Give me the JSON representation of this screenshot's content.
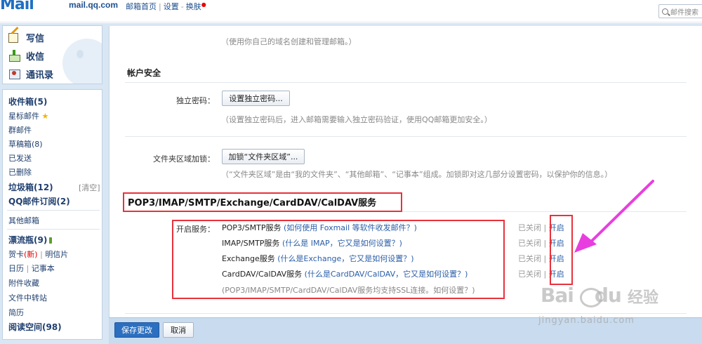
{
  "header": {
    "logo_text": "Mail",
    "logo_domain": "mail.qq.com",
    "nav": [
      "邮箱首页",
      "设置",
      "换肤"
    ],
    "search_placeholder": "邮件搜索"
  },
  "sidebar": {
    "actions": [
      {
        "label": "写信",
        "icon": "write-icon"
      },
      {
        "label": "收信",
        "icon": "inbox-icon"
      },
      {
        "label": "通讯录",
        "icon": "contacts-icon"
      }
    ],
    "inbox": "收件箱(5)",
    "starred": "星标邮件",
    "group": "群邮件",
    "drafts": "草稿箱(8)",
    "sent": "已发送",
    "deleted": "已删除",
    "spam": "垃圾箱(12)",
    "spam_clear": "[清空]",
    "subscriptions": "QQ邮件订阅(2)",
    "other": "其他邮箱",
    "drift": "漂流瓶(9)",
    "card": "贺卡",
    "card_new": "(新)",
    "postcard": "明信片",
    "calendar": "日历",
    "notes": "记事本",
    "attachments": "附件收藏",
    "transfer": "文件中转站",
    "resume": "简历",
    "reading": "阅读空间(98)",
    "bar": "|"
  },
  "main": {
    "domain_note": "（使用你自己的域名创建和管理邮箱。）",
    "account_security_title": "帐户安全",
    "independent_password_label": "独立密码：",
    "independent_password_button": "设置独立密码...",
    "independent_password_note": "（设置独立密码后，进入邮箱需要输入独立密码验证，使用QQ邮箱更加安全。）",
    "folder_lock_label": "文件夹区域加锁：",
    "folder_lock_button": "加锁“文件夹区域”...",
    "folder_lock_note": "（“文件夹区域”是由“我的文件夹”、“其他邮箱”、“记事本”组成。加锁即对这几部分设置密码，以保护你的信息。）",
    "pop_title": "POP3/IMAP/SMTP/Exchange/CardDAV/CalDAV服务",
    "enable_label": "开启服务：",
    "services": [
      {
        "name": "POP3/SMTP服务",
        "help": "(如何使用 Foxmail 等软件收发邮件？)",
        "status_off": "已关闭",
        "action": "开启"
      },
      {
        "name": "IMAP/SMTP服务",
        "help": "(什么是 IMAP，它又是如何设置？)",
        "status_off": "已关闭",
        "action": "开启"
      },
      {
        "name": "Exchange服务",
        "help": "(什么是Exchange，它又是如何设置？)",
        "status_off": "已关闭",
        "action": "开启"
      },
      {
        "name": "CardDAV/CalDAV服务",
        "help": "(什么是CardDAV/CalDAV，它又是如何设置？)",
        "status_off": "已关闭",
        "action": "开启"
      }
    ],
    "ssl_note": "(POP3/IMAP/SMTP/CardDAV/CalDAV服务均支持SSL连接。如何设置？)",
    "status_sep": "|"
  },
  "footer": {
    "save": "保存更改",
    "cancel": "取消"
  },
  "watermark": {
    "brand": "Bai",
    "brand_tail": "du",
    "suffix": "经验",
    "url": "jingyan.baidu.com"
  },
  "colors": {
    "annotation_red": "#e8323c",
    "arrow_magenta": "#e83ee0",
    "link_blue": "#2b5ea8",
    "primary_button": "#2c6fc0"
  }
}
